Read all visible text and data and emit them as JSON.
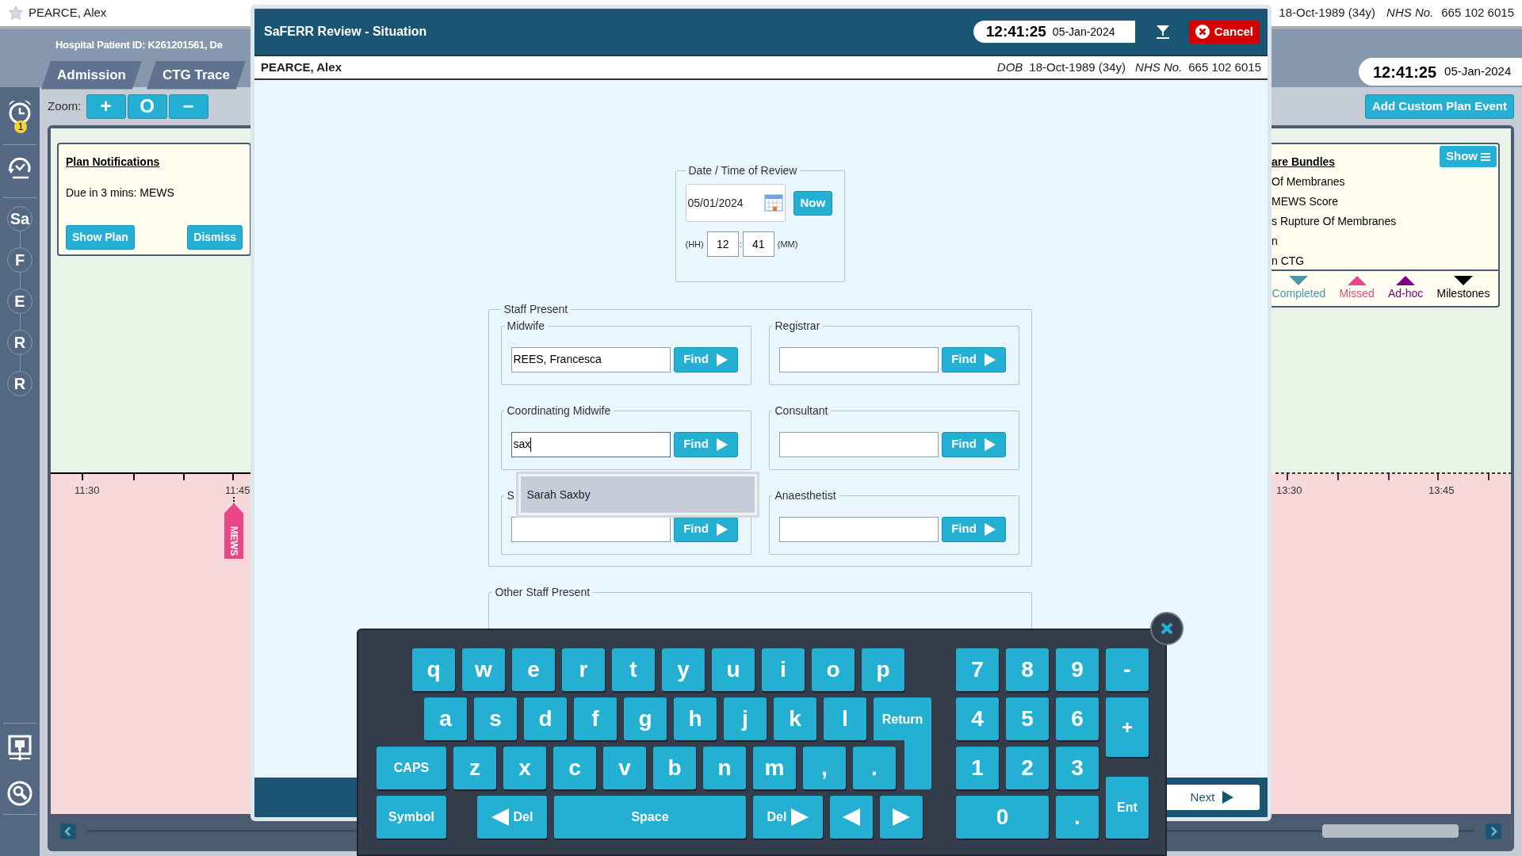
{
  "app_bar": {
    "patient_name": "PEARCE, Alex",
    "dob": "18-Oct-1989 (34y)",
    "nhs_label": "NHS No.",
    "nhs_number": "665 102 6015"
  },
  "header": {
    "patient_id": "Hospital Patient ID: K261201561, De",
    "tabs": [
      {
        "label": "Admission",
        "selected": false
      },
      {
        "label": "CTG Trace",
        "selected": false
      }
    ],
    "clock": {
      "time": "12:41:25",
      "date": "05-Jan-2024"
    }
  },
  "sidebar": {
    "alarm_badge": "1",
    "nodes": [
      "Sa",
      "F",
      "E",
      "R",
      "R"
    ]
  },
  "toolbar": {
    "zoom_label": "Zoom:",
    "zoom_buttons": [
      "+",
      "O",
      "−"
    ],
    "add_event_button": "Add Custom Plan Event"
  },
  "notifications": {
    "title": "Plan Notifications",
    "message": "Due in 3 mins: MEWS",
    "buttons": [
      "Show Plan",
      "Dismiss"
    ]
  },
  "timeline": {
    "left_ticks": [
      "11:30",
      "11:45"
    ],
    "right_ticks": [
      "13:30",
      "13:45"
    ],
    "events": [
      {
        "label": "MEWS",
        "color": "#e84686"
      }
    ]
  },
  "care_bundles": {
    "title": "are Bundles",
    "show_button": "Show",
    "items": [
      "Of Membranes",
      "MEWS Score",
      "s Rupture Of Membranes",
      "n",
      "n CTG"
    ],
    "legend": [
      {
        "label": "Completed",
        "color": "#4a9aa6",
        "kind": "down"
      },
      {
        "label": "Missed",
        "color": "#e84686",
        "kind": "up"
      },
      {
        "label": "Ad-hoc",
        "color": "#800080",
        "kind": "up"
      },
      {
        "label": "Milestones",
        "color": "#000000",
        "kind": "down"
      }
    ]
  },
  "modal": {
    "title": "SaFERR Review - Situation",
    "clock": {
      "time": "12:41:25",
      "date": "05-Jan-2024"
    },
    "cancel_button": "Cancel",
    "patient": {
      "name": "PEARCE, Alex",
      "dob_label": "DOB",
      "dob": "18-Oct-1989 (34y)",
      "nhs_label": "NHS No.",
      "nhs_number": "665 102 6015"
    },
    "review_time": {
      "legend": "Date / Time of Review",
      "date": "05/01/2024",
      "now_button": "Now",
      "hh_label": "(HH)",
      "hour": "12",
      "separator": ":",
      "minute": "41",
      "mm_label": "(MM)"
    },
    "staff_present": {
      "legend": "Staff Present",
      "roles": [
        {
          "label": "Midwife",
          "value": "REES, Francesca",
          "button": "Find"
        },
        {
          "label": "Registrar",
          "button": "Find"
        },
        {
          "label": "Coordinating Midwife",
          "value": "sax",
          "button": "Find",
          "focused": true
        },
        {
          "label": "Consultant",
          "button": "Find"
        },
        {
          "label": "S",
          "button": "Find"
        },
        {
          "label": "Anaesthetist",
          "button": "Find"
        }
      ]
    },
    "autocomplete": [
      {
        "label": "Sarah Saxby",
        "selected": true
      }
    ],
    "other_staff": {
      "legend": "Other Staff Present"
    },
    "next_button": "Next"
  },
  "keyboard": {
    "rows": [
      {
        "keys": [
          {
            "label": "q",
            "kind": "char"
          },
          {
            "label": "w",
            "kind": "char"
          },
          {
            "label": "e",
            "kind": "char"
          },
          {
            "label": "r",
            "kind": "char"
          },
          {
            "label": "t",
            "kind": "char"
          },
          {
            "label": "y",
            "kind": "char"
          },
          {
            "label": "u",
            "kind": "char"
          },
          {
            "label": "i",
            "kind": "char"
          },
          {
            "label": "o",
            "kind": "char"
          },
          {
            "label": "p",
            "kind": "char"
          }
        ]
      },
      {
        "keys": [
          {
            "label": "a",
            "kind": "char"
          },
          {
            "label": "s",
            "kind": "char"
          },
          {
            "label": "d",
            "kind": "char"
          },
          {
            "label": "f",
            "kind": "char"
          },
          {
            "label": "g",
            "kind": "char"
          },
          {
            "label": "h",
            "kind": "char"
          },
          {
            "label": "j",
            "kind": "char"
          },
          {
            "label": "k",
            "kind": "char"
          },
          {
            "label": "l",
            "kind": "char"
          },
          {
            "label": "Return",
            "kind": "return"
          }
        ]
      },
      {
        "keys": [
          {
            "label": "CAPS",
            "kind": "wide"
          },
          {
            "label": "z",
            "kind": "char"
          },
          {
            "label": "x",
            "kind": "char"
          },
          {
            "label": "c",
            "kind": "char"
          },
          {
            "label": "v",
            "kind": "char"
          },
          {
            "label": "b",
            "kind": "char"
          },
          {
            "label": "n",
            "kind": "char"
          },
          {
            "label": "m",
            "kind": "char"
          },
          {
            "label": ",",
            "kind": "char"
          },
          {
            "label": ".",
            "kind": "char"
          }
        ]
      },
      {
        "keys": [
          {
            "label": "Symbol",
            "kind": "wide"
          },
          {
            "label": "Del",
            "kind": "del_left"
          },
          {
            "label": "Space",
            "kind": "space"
          },
          {
            "label": "Del",
            "kind": "del_right"
          },
          {
            "kind": "arrow_left"
          },
          {
            "kind": "arrow_right"
          }
        ]
      }
    ],
    "numpad": [
      {
        "label": "7",
        "kind": "digit"
      },
      {
        "label": "8",
        "kind": "digit"
      },
      {
        "label": "9",
        "kind": "digit"
      },
      {
        "label": "-",
        "kind": "digit"
      },
      {
        "label": "4",
        "kind": "digit"
      },
      {
        "label": "5",
        "kind": "digit"
      },
      {
        "label": "6",
        "kind": "digit"
      },
      {
        "label": "+",
        "kind": "plus"
      },
      {
        "label": "1",
        "kind": "digit"
      },
      {
        "label": "2",
        "kind": "digit"
      },
      {
        "label": "3",
        "kind": "digit"
      },
      {
        "label": "0",
        "kind": "zero"
      },
      {
        "label": ".",
        "kind": "digit"
      },
      {
        "label": "Ent",
        "kind": "enter"
      }
    ]
  }
}
